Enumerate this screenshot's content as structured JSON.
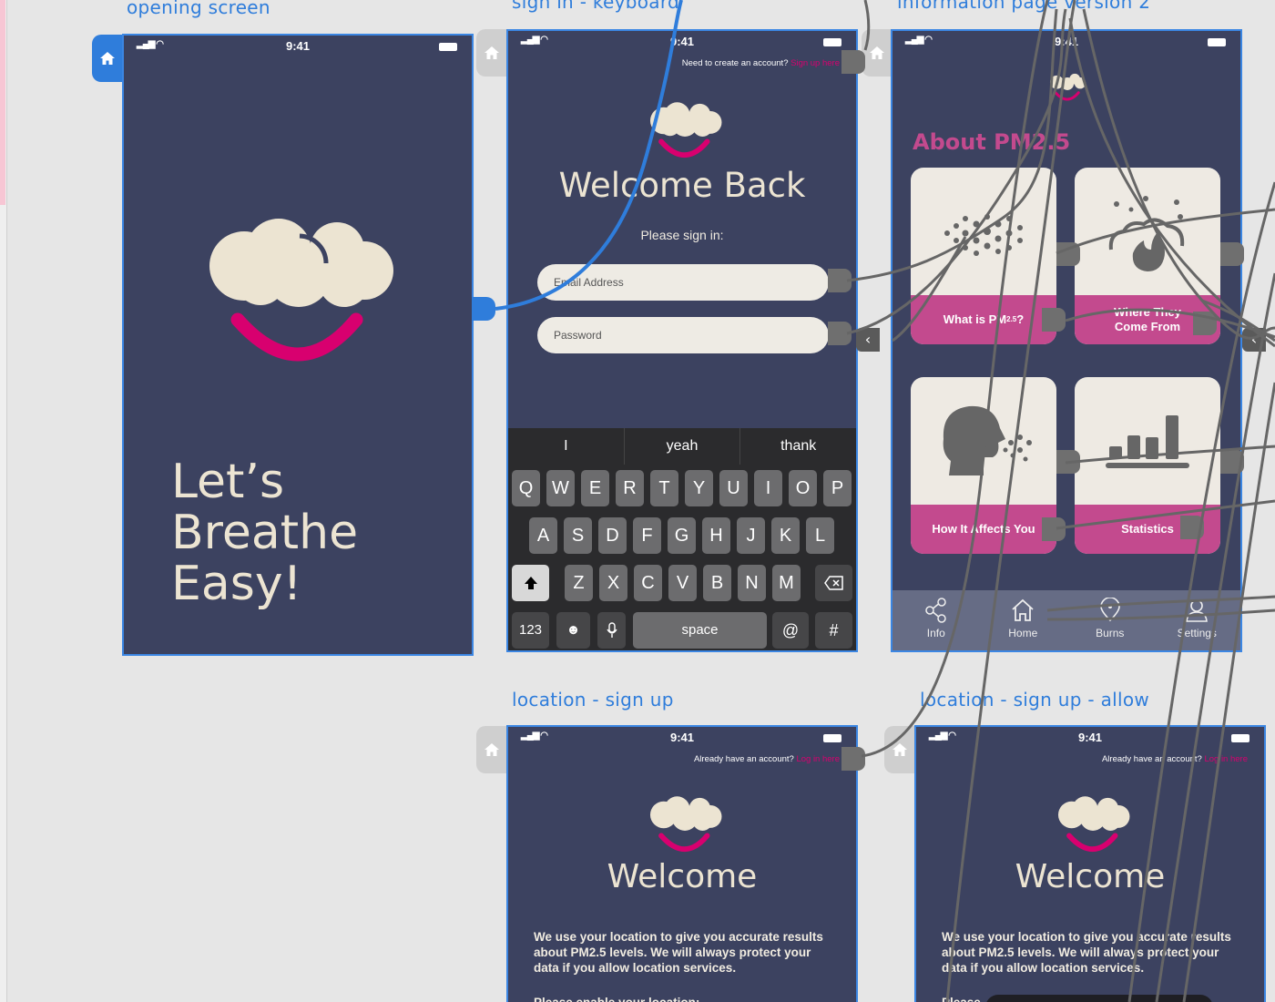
{
  "artboards": {
    "opening": {
      "label": "opening screen",
      "time": "9:41",
      "headline": [
        "Let’s",
        "Breathe",
        "Easy!"
      ]
    },
    "signin": {
      "label": "sign in - keyboard",
      "time": "9:41",
      "prompt_text": "Need to create an account?",
      "prompt_link": "Sign up here",
      "title": "Welcome Back",
      "subtitle": "Please sign in:",
      "email_placeholder": "Email Address",
      "password_placeholder": "Password",
      "keyboard": {
        "suggestions": [
          "I",
          "yeah",
          "thank"
        ],
        "row1": [
          "Q",
          "W",
          "E",
          "R",
          "T",
          "Y",
          "U",
          "I",
          "O",
          "P"
        ],
        "row2": [
          "A",
          "S",
          "D",
          "F",
          "G",
          "H",
          "J",
          "K",
          "L"
        ],
        "row3": [
          "Z",
          "X",
          "C",
          "V",
          "B",
          "N",
          "M"
        ],
        "numbers_label": "123",
        "space_label": "space",
        "at_label": "@",
        "hash_label": "#"
      }
    },
    "info": {
      "label": "information page version 2",
      "time": "9:41",
      "heading": "About PM2.5",
      "tiles": [
        {
          "label": "What is PM",
          "sub": "2.5",
          "suffix": " ?"
        },
        {
          "label": "Where They Come From"
        },
        {
          "label": "How It Affects You"
        },
        {
          "label": "Statistics"
        }
      ],
      "tabs": [
        "Info",
        "Home",
        "Burns",
        "Settings"
      ]
    },
    "location_signup": {
      "label": "location - sign up",
      "time": "9:41",
      "prompt_text": "Already have an account?",
      "prompt_link": "Log in here",
      "title": "Welcome",
      "body": "We use your location to give you accurate results about PM2.5 levels. We will always protect your data if you allow location services.",
      "enable_text": "Please enable your location:"
    },
    "location_allow": {
      "label": "location - sign up - allow",
      "time": "9:41",
      "prompt_text": "Already have an account?",
      "prompt_link": "Log in here",
      "title": "Welcome",
      "body": "We use your location to give you accurate results about PM2.5 levels. We will always protect your data if you allow location services.",
      "enable_text": "Please"
    }
  },
  "colors": {
    "phone_bg": "#3c4260",
    "cream": "#ece4d2",
    "magenta": "#d8006f",
    "tile_band": "#c34a8e",
    "selection_blue": "#2f7ddb"
  }
}
